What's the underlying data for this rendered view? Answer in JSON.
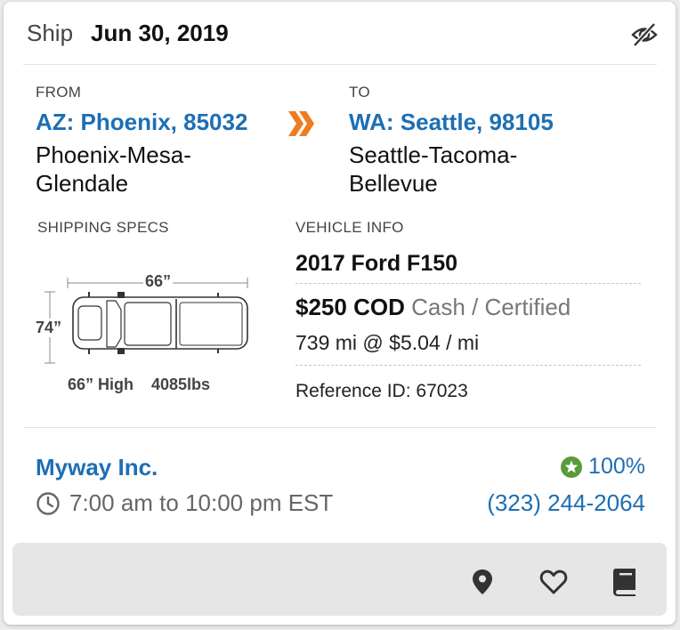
{
  "header": {
    "ship_label": "Ship",
    "date": "Jun 30, 2019"
  },
  "route": {
    "from_label": "FROM",
    "from_location": "AZ: Phoenix, 85032",
    "from_area": "Phoenix-Mesa-Glendale",
    "to_label": "TO",
    "to_location": "WA: Seattle, 98105",
    "to_area": "Seattle-Tacoma-Bellevue"
  },
  "specs": {
    "label": "SHIPPING SPECS",
    "length": "66”",
    "width": "74”",
    "height": "66” High",
    "weight": "4085lbs"
  },
  "vehicle": {
    "label": "VEHICLE INFO",
    "name": "2017 Ford F150",
    "price": "$250 COD",
    "payment": "Cash / Certified",
    "rate": "739 mi @ $5.04 / mi",
    "reference": "Reference ID: 67023"
  },
  "shipper": {
    "company": "Myway Inc.",
    "rating": "100%",
    "hours": "7:00 am to 10:00 pm EST",
    "phone": "(323) 244-2064"
  },
  "colors": {
    "link": "#1d6fb4",
    "accent": "#f07b1e",
    "star": "#5a9a3c"
  }
}
